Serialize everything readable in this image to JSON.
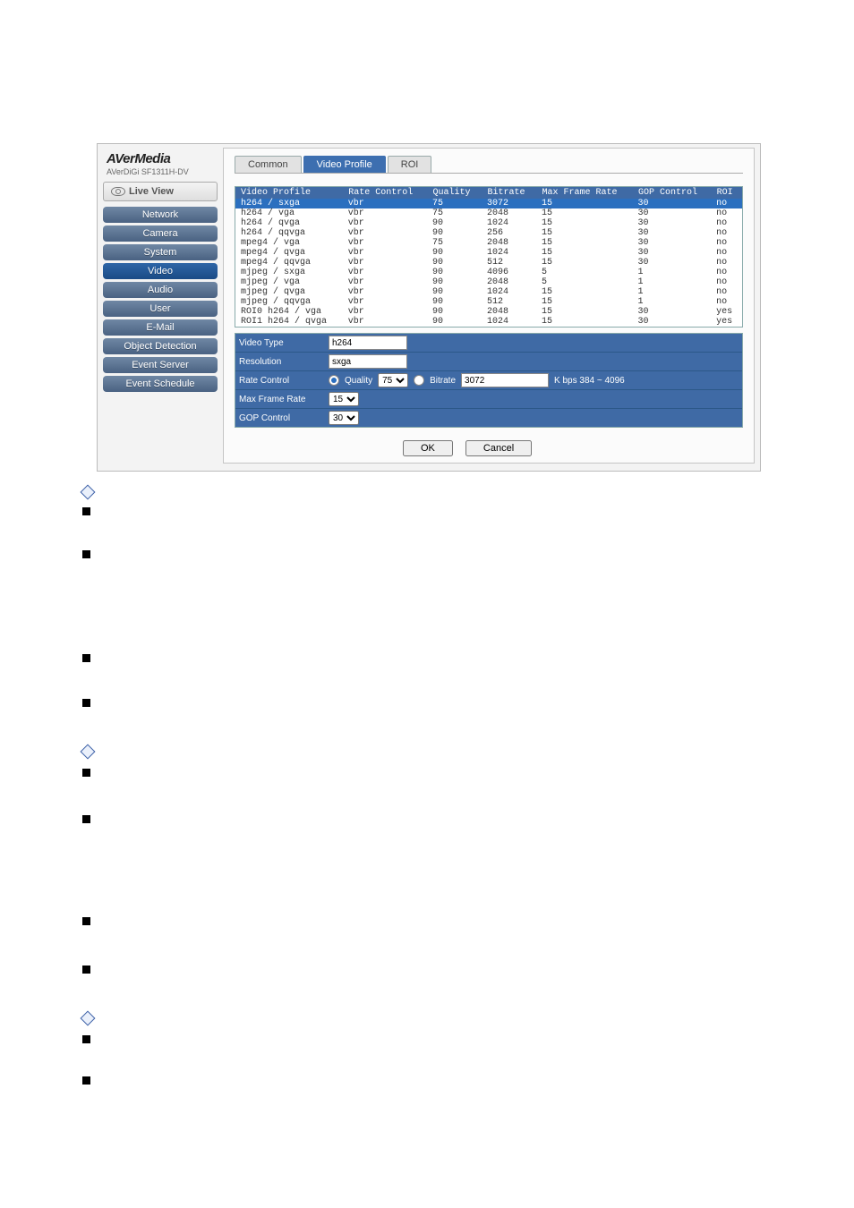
{
  "brand": {
    "line1": "AVerMedia",
    "line2": "AVerDiGi SF1311H-DV"
  },
  "live": "Live View",
  "nav": [
    "Network",
    "Camera",
    "System",
    "Video",
    "Audio",
    "User",
    "E-Mail",
    "Object Detection",
    "Event Server",
    "Event Schedule"
  ],
  "nav_active_index": 3,
  "tabs": {
    "items": [
      "Common",
      "Video Profile",
      "ROI"
    ],
    "active": 1
  },
  "table": {
    "headers": [
      "Video Profile",
      "Rate Control",
      "Quality",
      "Bitrate",
      "Max Frame Rate",
      "GOP Control",
      "ROI"
    ],
    "rows": [
      [
        "h264 / sxga",
        "vbr",
        "75",
        "3072",
        "15",
        "30",
        "no"
      ],
      [
        "h264 / vga",
        "vbr",
        "75",
        "2048",
        "15",
        "30",
        "no"
      ],
      [
        "h264 / qvga",
        "vbr",
        "90",
        "1024",
        "15",
        "30",
        "no"
      ],
      [
        "h264 / qqvga",
        "vbr",
        "90",
        "256",
        "15",
        "30",
        "no"
      ],
      [
        "mpeg4 / vga",
        "vbr",
        "75",
        "2048",
        "15",
        "30",
        "no"
      ],
      [
        "mpeg4 / qvga",
        "vbr",
        "90",
        "1024",
        "15",
        "30",
        "no"
      ],
      [
        "mpeg4 / qqvga",
        "vbr",
        "90",
        "512",
        "15",
        "30",
        "no"
      ],
      [
        "mjpeg / sxga",
        "vbr",
        "90",
        "4096",
        "5",
        "1",
        "no"
      ],
      [
        "mjpeg / vga",
        "vbr",
        "90",
        "2048",
        "5",
        "1",
        "no"
      ],
      [
        "mjpeg / qvga",
        "vbr",
        "90",
        "1024",
        "15",
        "1",
        "no"
      ],
      [
        "mjpeg / qqvga",
        "vbr",
        "90",
        "512",
        "15",
        "1",
        "no"
      ],
      [
        "ROI0 h264 / vga",
        "vbr",
        "90",
        "2048",
        "15",
        "30",
        "yes"
      ],
      [
        "ROI1 h264 / qvga",
        "vbr",
        "90",
        "1024",
        "15",
        "30",
        "yes"
      ]
    ],
    "selected": 0
  },
  "form": {
    "video_type": {
      "label": "Video Type",
      "value": "h264"
    },
    "resolution": {
      "label": "Resolution",
      "value": "sxga"
    },
    "rate_control": {
      "label": "Rate Control",
      "quality_label": "Quality",
      "quality_value": "75",
      "bitrate_label": "Bitrate",
      "bitrate_value": "3072",
      "hint": "K bps 384 ~ 4096"
    },
    "max_frame_rate": {
      "label": "Max Frame Rate",
      "value": "15"
    },
    "gop_control": {
      "label": "GOP Control",
      "value": "30"
    }
  },
  "buttons": {
    "ok": "OK",
    "cancel": "Cancel"
  }
}
